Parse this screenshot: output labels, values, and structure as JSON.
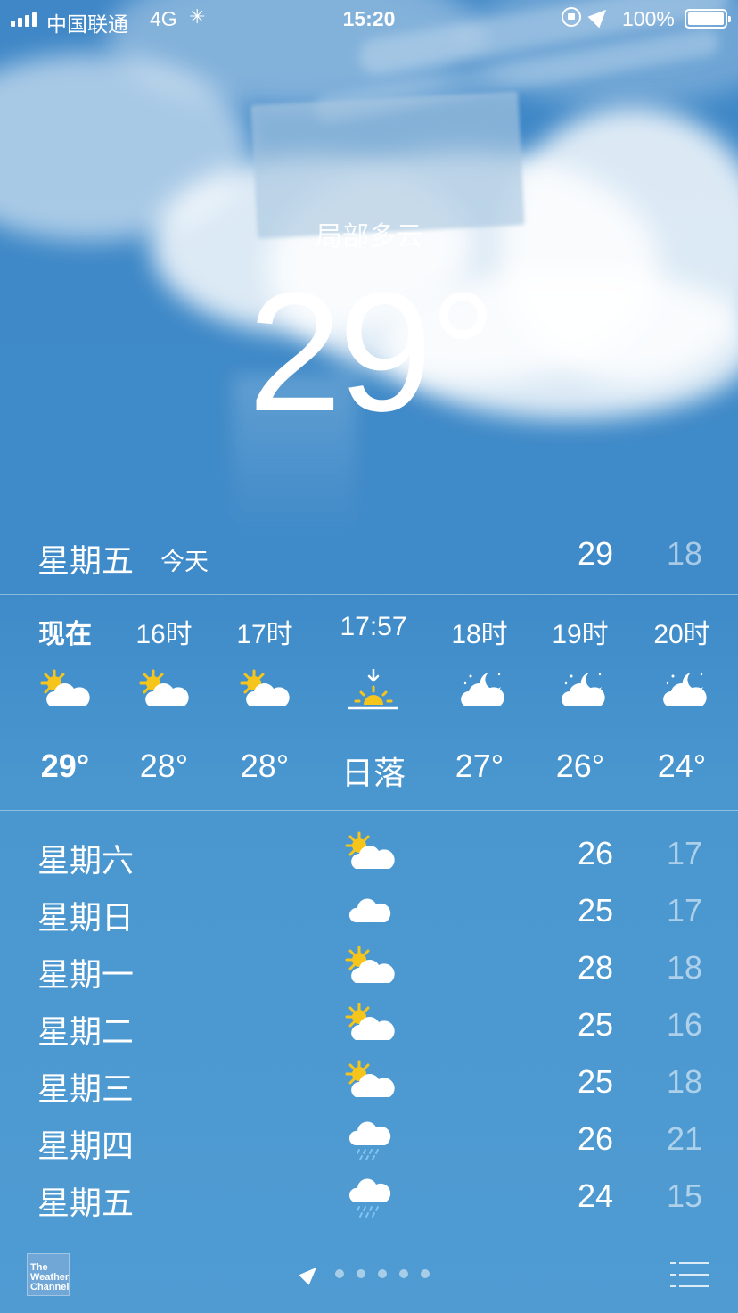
{
  "status_bar": {
    "carrier": "中国联通",
    "network": "4G",
    "time": "15:20",
    "battery": "100%"
  },
  "current": {
    "condition": "局部多云",
    "temperature": "29°"
  },
  "today": {
    "day": "星期五",
    "label": "今天",
    "high": "29",
    "low": "18"
  },
  "hourly": [
    {
      "time": "现在",
      "icon": "partly-cloudy-day-icon",
      "temp": "29°"
    },
    {
      "time": "16时",
      "icon": "partly-cloudy-day-icon",
      "temp": "28°"
    },
    {
      "time": "17时",
      "icon": "partly-cloudy-day-icon",
      "temp": "28°"
    },
    {
      "time": "17:57",
      "icon": "sunset-icon",
      "temp": "日落"
    },
    {
      "time": "18时",
      "icon": "partly-cloudy-night-icon",
      "temp": "27°"
    },
    {
      "time": "19时",
      "icon": "partly-cloudy-night-icon",
      "temp": "26°"
    },
    {
      "time": "20时",
      "icon": "partly-cloudy-night-icon",
      "temp": "24°"
    }
  ],
  "daily": [
    {
      "day": "星期六",
      "icon": "partly-cloudy-day-icon",
      "high": "26",
      "low": "17"
    },
    {
      "day": "星期日",
      "icon": "cloud-icon",
      "high": "25",
      "low": "17"
    },
    {
      "day": "星期一",
      "icon": "partly-cloudy-day-icon",
      "high": "28",
      "low": "18"
    },
    {
      "day": "星期二",
      "icon": "partly-cloudy-day-icon",
      "high": "25",
      "low": "16"
    },
    {
      "day": "星期三",
      "icon": "partly-cloudy-day-icon",
      "high": "25",
      "low": "18"
    },
    {
      "day": "星期四",
      "icon": "rain-icon",
      "high": "26",
      "low": "21"
    },
    {
      "day": "星期五",
      "icon": "rain-icon",
      "high": "24",
      "low": "15"
    }
  ],
  "footer": {
    "weather_channel_logo": "The Weather Channel",
    "page_count": 5
  },
  "colors": {
    "background": "#3f8bc9",
    "sun": "#f6c51c",
    "low_temp": "rgba(255,255,255,0.55)"
  }
}
